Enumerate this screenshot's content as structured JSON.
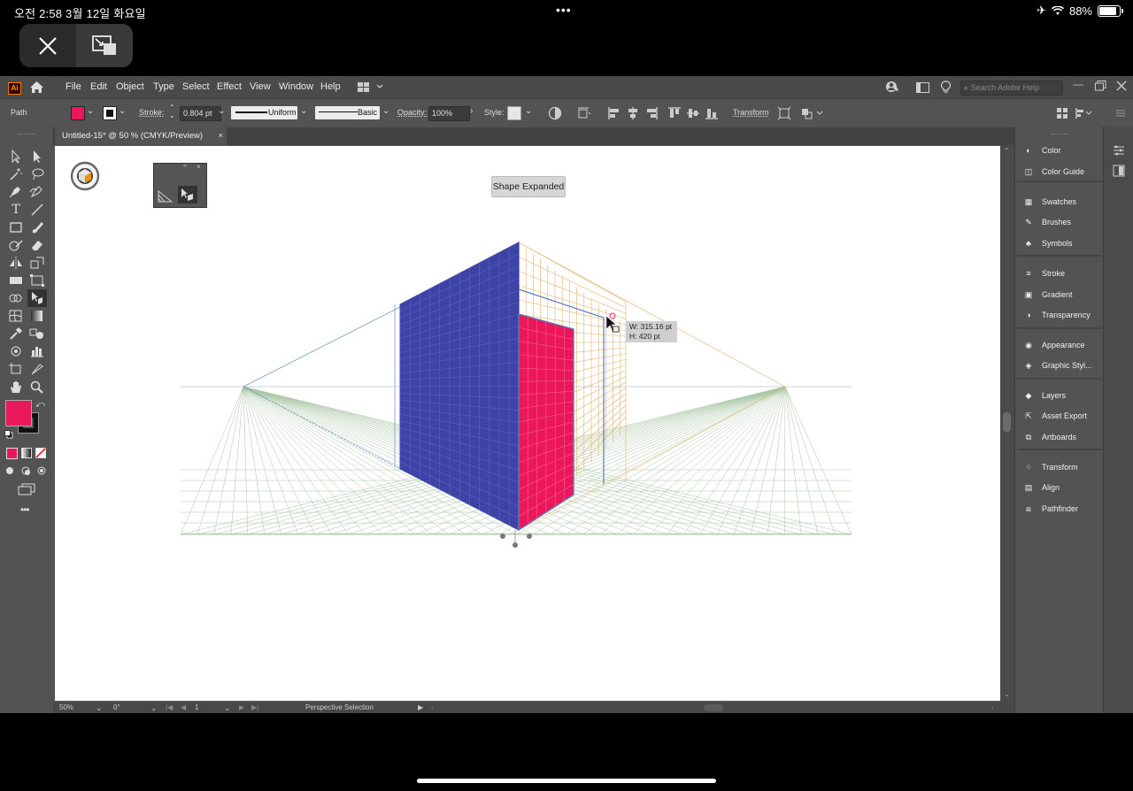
{
  "status_bar": {
    "time_date": "오전 2:58   3월 12일 화요일",
    "battery": "88%"
  },
  "menu": [
    "File",
    "Edit",
    "Object",
    "Type",
    "Select",
    "Effect",
    "View",
    "Window",
    "Help"
  ],
  "search_placeholder": "Search Adobe Help",
  "control_bar": {
    "selection": "Path",
    "stroke_label": "Stroke:",
    "stroke_value": "0.804 pt",
    "profile": "Uniform",
    "brush": "Basic",
    "opacity_label": "Opacity:",
    "opacity_value": "100%",
    "style_label": "Style:",
    "transform_label": "Transform",
    "fill_color": "#e8185a"
  },
  "document_tab": {
    "title": "Untitled-15* @ 50 % (CMYK/Preview)",
    "close": "×"
  },
  "canvas": {
    "tooltip": "Shape Expanded",
    "measure_w": "W: 315.16 pt",
    "measure_h": "H: 420 pt",
    "colors": {
      "left_plane": "#3d44a6",
      "right_plane": "#ec175a"
    }
  },
  "status_bottom": {
    "zoom": "50%",
    "rotation": "0°",
    "artboard": "1",
    "tool": "Perspective Selection"
  },
  "panels": [
    {
      "label": "Color",
      "icon": "color-icon"
    },
    {
      "label": "Color Guide",
      "icon": "color-guide-icon"
    },
    {
      "label": "Swatches",
      "icon": "swatches-icon"
    },
    {
      "label": "Brushes",
      "icon": "brushes-icon"
    },
    {
      "label": "Symbols",
      "icon": "symbols-icon"
    },
    {
      "label": "Stroke",
      "icon": "stroke-icon"
    },
    {
      "label": "Gradient",
      "icon": "gradient-icon"
    },
    {
      "label": "Transparency",
      "icon": "transparency-icon"
    },
    {
      "label": "Appearance",
      "icon": "appearance-icon"
    },
    {
      "label": "Graphic Styl...",
      "icon": "graphic-styles-icon"
    },
    {
      "label": "Layers",
      "icon": "layers-icon"
    },
    {
      "label": "Asset Export",
      "icon": "asset-export-icon"
    },
    {
      "label": "Artboards",
      "icon": "artboards-icon"
    },
    {
      "label": "Transform",
      "icon": "transform-icon"
    },
    {
      "label": "Align",
      "icon": "align-icon"
    },
    {
      "label": "Pathfinder",
      "icon": "pathfinder-icon"
    }
  ]
}
